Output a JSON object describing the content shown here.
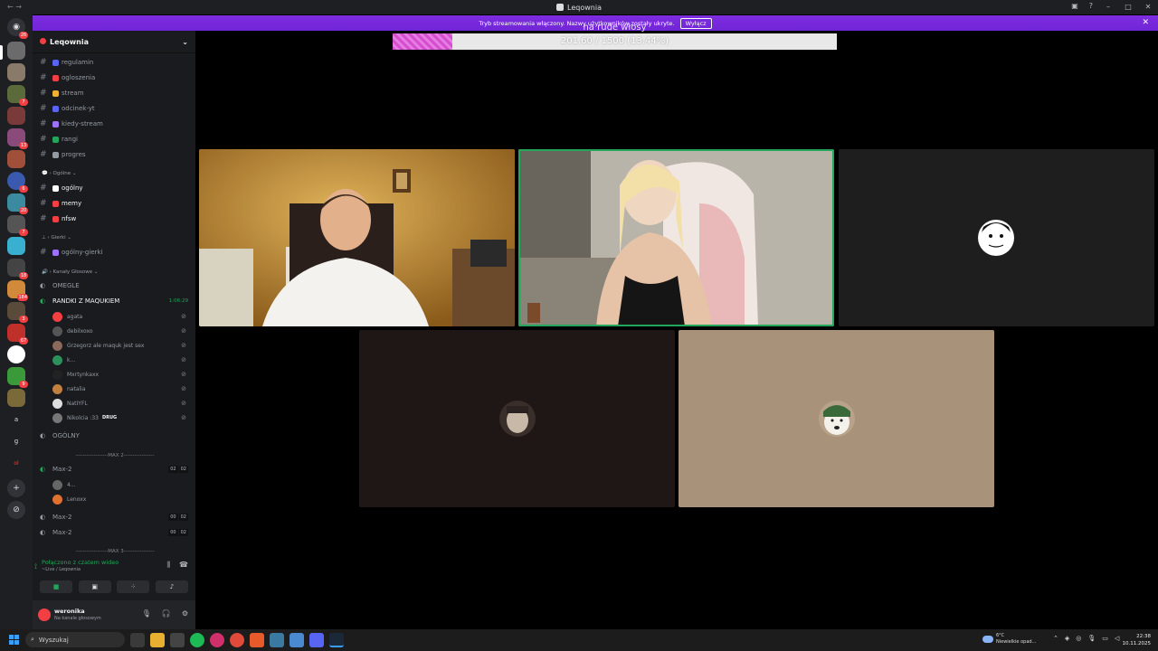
{
  "window": {
    "title": "Leqownia"
  },
  "banner": {
    "text": "Tryb streamowania włączony. Nazwy użytkowników zostały ukryte.",
    "button": "Wyłącz"
  },
  "stream_overlay": {
    "title": "na rude włosy",
    "progress_text": "201.60 / 1500 (13.44%)",
    "progress_fraction": 0.1344
  },
  "server_badges": [
    "26",
    "7",
    "13",
    "6",
    "20",
    "7",
    "18",
    "184",
    "3",
    "67",
    "9"
  ],
  "guild": {
    "name": "Leqownia"
  },
  "channels": [
    {
      "name": "regulamin",
      "color": "#5865f2"
    },
    {
      "name": "ogloszenia",
      "color": "#f23f43"
    },
    {
      "name": "stream",
      "color": "#f0b232"
    },
    {
      "name": "odcinek-yt",
      "color": "#5865f2"
    },
    {
      "name": "kiedy-stream",
      "color": "#a070ff"
    },
    {
      "name": "rangi",
      "color": "#23a55a"
    },
    {
      "name": "progres",
      "color": "#949ba4"
    }
  ],
  "category_ogolne": "Ogólne",
  "channels_ogolne": [
    {
      "name": "ogólny",
      "color": "#ffffff"
    },
    {
      "name": "memy",
      "color": "#f23f43"
    },
    {
      "name": "nfsw",
      "color": "#f23f43"
    }
  ],
  "category_gierki": "Gierki",
  "channel_gierki": "ogólny-gierki",
  "category_voice": "Kanały Głosowe",
  "voice": {
    "omegle": "OMEGLE",
    "randki": "RANDKI Z MAQUKIEM",
    "randki_timer": "1:06:29",
    "members": [
      {
        "name": "agata",
        "color": "#f23f43"
      },
      {
        "name": "debilxoxo",
        "color": "#555"
      },
      {
        "name": "Grzegorz ale maquk jest sex",
        "color": "#8a6a5a"
      },
      {
        "name": "k...",
        "color": "#2d8f5a"
      },
      {
        "name": "Mxrtynkaxx",
        "color": "#222"
      },
      {
        "name": "natalia",
        "color": "#c08040"
      },
      {
        "name": "NatIYFL",
        "color": "#ddd"
      },
      {
        "name": "Nikolcia :33",
        "color": "#777"
      }
    ],
    "nikolcia_tag": "DRUG",
    "ogolny": "OGÓLNY",
    "divider1": "------------------MAX 2-----------------",
    "max1": "Max-2",
    "max1_count": [
      "02",
      "02"
    ],
    "max1_members": [
      {
        "name": "4...",
        "color": "#666"
      },
      {
        "name": "Lenoxx",
        "color": "#e07030"
      }
    ],
    "max2": "Max-2",
    "max2_count": [
      "00",
      "02"
    ],
    "max3": "Max-2",
    "max3_count": [
      "00",
      "02"
    ],
    "divider2": "------------------MAX 3-----------------"
  },
  "rtc": {
    "status": "Połączono z czatem wideo",
    "location": "~Live / Leqownia"
  },
  "user": {
    "name": "weronika",
    "status": "Na kanale głosowym"
  },
  "taskbar": {
    "search": "Wyszukaj",
    "weather_temp": "6°C",
    "weather_desc": "Niewielkie opad...",
    "time": "22:38",
    "date": "10.11.2025"
  }
}
